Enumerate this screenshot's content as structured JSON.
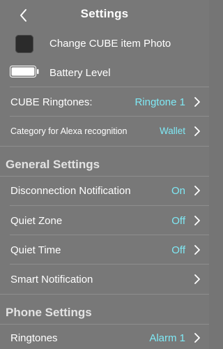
{
  "header": {
    "title": "Settings",
    "back_icon": "chevron-left-icon"
  },
  "items": {
    "change_photo": {
      "label": "Change CUBE item Photo",
      "icon": "cube-photo-thumbnail"
    },
    "battery_level": {
      "label": "Battery Level",
      "icon": "battery-full-icon",
      "level": 1.0
    },
    "cube_ringtones": {
      "label": "CUBE Ringtones:",
      "value": "Ringtone 1"
    },
    "alexa_category": {
      "label": "Category for Alexa recognition",
      "value": "Wallet"
    }
  },
  "general": {
    "title": "General Settings",
    "disconnection": {
      "label": "Disconnection Notification",
      "value": "On"
    },
    "quiet_zone": {
      "label": "Quiet Zone",
      "value": "Off"
    },
    "quiet_time": {
      "label": "Quiet Time",
      "value": "Off"
    },
    "smart_notification": {
      "label": "Smart Notification"
    }
  },
  "phone": {
    "title": "Phone Settings",
    "ringtones": {
      "label": "Ringtones",
      "value": "Alarm 1"
    }
  },
  "colors": {
    "background": "#787878",
    "value_accent": "#7fe9f5",
    "text": "#ffffff",
    "section_header": "#e3e3e3"
  }
}
